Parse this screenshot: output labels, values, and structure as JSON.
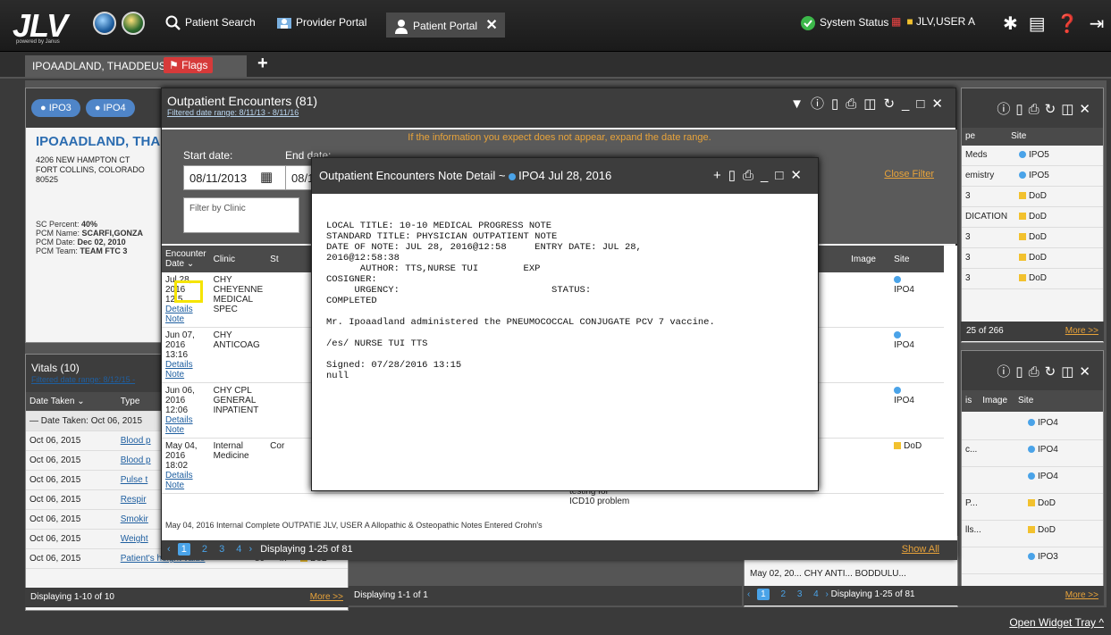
{
  "app": {
    "logo": "JLV",
    "logo_sub": "powered by Janus"
  },
  "nav": {
    "patient_search": "Patient Search",
    "provider_portal": "Provider Portal",
    "patient_portal": "Patient Portal",
    "system_status": "System Status",
    "user": "JLV,USER A"
  },
  "patient_tab": {
    "name": "IPOAADLAND, THADDEUS A",
    "flags": "Flags"
  },
  "left_widget": {
    "tabs": [
      "IPO3",
      "IPO4"
    ],
    "name": "IPOAADLAND, THA",
    "address": [
      "4206 NEW HAMPTON CT",
      "FORT COLLINS, COLORADO",
      "80525"
    ],
    "info": [
      {
        "k": "SC Percent:",
        "v": "40%"
      },
      {
        "k": "PCM Name:",
        "v": "SCARFI,GONZA"
      },
      {
        "k": "PCM Date:",
        "v": "Dec 02, 2010"
      },
      {
        "k": "PCM Team:",
        "v": "TEAM FTC 3"
      }
    ]
  },
  "vitals": {
    "title": "Vitals (10)",
    "filter": "Filtered date range: 8/12/15 -",
    "headers": [
      "Date Taken",
      "Type"
    ],
    "group": "— Date Taken: Oct 06, 2015",
    "rows": [
      {
        "date": "Oct 06, 2015",
        "type": "Blood p"
      },
      {
        "date": "Oct 06, 2015",
        "type": "Blood p"
      },
      {
        "date": "Oct 06, 2015",
        "type": "Pulse t"
      },
      {
        "date": "Oct 06, 2015",
        "type": "Respir"
      },
      {
        "date": "Oct 06, 2015",
        "type": "Smokir"
      },
      {
        "date": "Oct 06, 2015",
        "type": "Weight"
      },
      {
        "date": "Oct 06, 2015",
        "type": "Patient's height value",
        "extra": "80",
        "unit": "in",
        "site": "DoD"
      }
    ],
    "footer": "Displaying 1-10 of 10",
    "more": "More >>"
  },
  "outpatient": {
    "title": "Outpatient Encounters (81)",
    "filter": "Filtered date range: 8/11/13 - 8/11/16",
    "notice": "If the information you expect does not appear, expand the date range.",
    "start_label": "Start date:",
    "start_value": "08/11/2013",
    "end_label": "End date:",
    "end_value": "08/1",
    "clinic_placeholder": "Filter by Clinic",
    "close_filter": "Close Filter",
    "headers": [
      "Encounter Date",
      "Clinic",
      "St",
      "sis",
      "Image",
      "Site"
    ],
    "rows": [
      {
        "date": "Jul 28, 2016",
        "time": "12:5",
        "clinic": "CHY CHEYENNE MEDICAL SPEC",
        "site": "IPO4"
      },
      {
        "date": "Jun 07, 2016",
        "time": "13:16",
        "clinic": "CHY ANTICOAG",
        "site": "IPO4"
      },
      {
        "date": "Jun 06, 2016",
        "time": "12:06",
        "clinic": "CHY CPL GENERAL INPATIENT",
        "site": "IPO4"
      },
      {
        "date": "May 04, 2016",
        "time": "18:02",
        "clinic": "Internal Medicine",
        "status": "Cor",
        "site": "DoD"
      }
    ],
    "extra_text": [
      "testing for",
      "ICD10 problem"
    ],
    "row5": "May 04, 2016   Internal   Complete  OUTPATIE   JLV, USER A  Allopathic & Osteopathic   Notes Entered  Crohn's",
    "details": "Details",
    "note": "Note",
    "pages": [
      "1",
      "2",
      "3",
      "4"
    ],
    "displaying": "Displaying 1-25 of 81",
    "show_all": "Show All"
  },
  "note_modal": {
    "title": "Outpatient Encounters Note Detail ~",
    "site": "IPO4 Jul 28, 2016",
    "text": "LOCAL TITLE: 10-10 MEDICAL PROGRESS NOTE\nSTANDARD TITLE: PHYSICIAN OUTPATIENT NOTE\nDATE OF NOTE: JUL 28, 2016@12:58     ENTRY DATE: JUL 28,\n2016@12:58:38\n      AUTHOR: TTS,NURSE TUI        EXP\nCOSIGNER:\n     URGENCY:                           STATUS:\nCOMPLETED\n\nMr. Ipoaadland administered the PNEUMOCOCCAL CONJUGATE PCV 7 vaccine.\n\n/es/ NURSE TUI TTS\n\nSigned: 07/28/2016 13:15\nnull"
  },
  "right_widget1": {
    "headers": [
      "pe",
      "Site"
    ],
    "rows": [
      {
        "t": "Meds",
        "site": "IPO5"
      },
      {
        "t": "emistry",
        "site": "IPO5"
      },
      {
        "t": "3",
        "site": "DoD"
      },
      {
        "t": "DICATION",
        "site": "DoD"
      },
      {
        "t": "3",
        "site": "DoD"
      },
      {
        "t": "3",
        "site": "DoD"
      },
      {
        "t": "3",
        "site": "DoD"
      }
    ],
    "footer": "25 of 266",
    "more": "More >>"
  },
  "right_widget2": {
    "headers": [
      "is",
      "Image",
      "Site"
    ],
    "rows": [
      {
        "t": "",
        "site": "IPO4"
      },
      {
        "t": "c...",
        "site": "IPO4"
      },
      {
        "t": "",
        "site": "IPO4"
      },
      {
        "t": "P...",
        "site": "DoD"
      },
      {
        "t": "lls...",
        "site": "DoD"
      },
      {
        "t": "",
        "site": "IPO3"
      }
    ],
    "more": "More >>"
  },
  "bottom": {
    "middle_footer": "Displaying 1-1 of 1",
    "right_row": "May 02, 20...  CHY ANTI...  BODDULU...",
    "right_footer": "Displaying 1-25 of 81",
    "pages": [
      "1",
      "2",
      "3",
      "4"
    ],
    "widget_tray": "Open Widget Tray"
  }
}
